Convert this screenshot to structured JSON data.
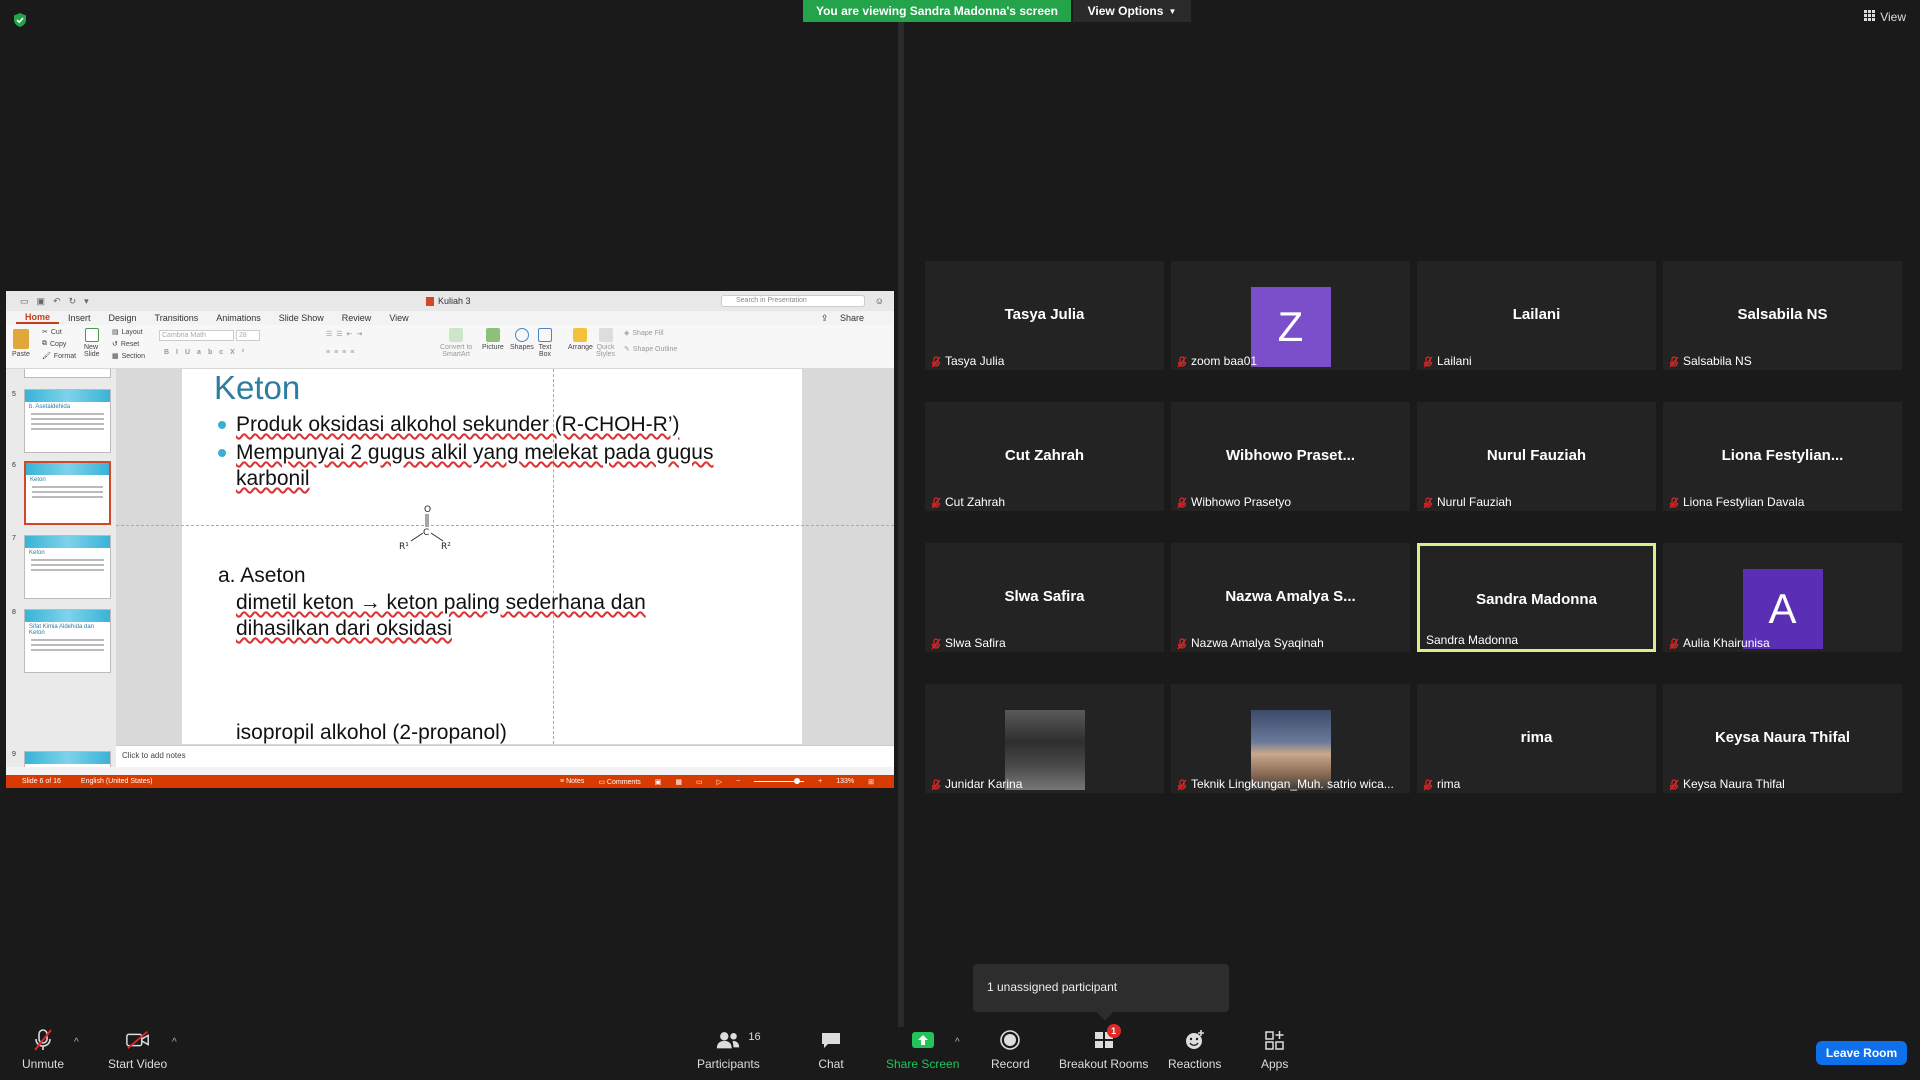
{
  "banner": {
    "viewing_text": "You are viewing Sandra Madonna's screen",
    "view_options_label": "View Options",
    "view_label": "View"
  },
  "ppt": {
    "file_name": "Kuliah 3",
    "search_placeholder": "Search in Presentation",
    "tabs": [
      "Home",
      "Insert",
      "Design",
      "Transitions",
      "Animations",
      "Slide Show",
      "Review",
      "View"
    ],
    "share_label": "Share",
    "ribbon": {
      "paste": "Paste",
      "cut": "Cut",
      "copy": "Copy",
      "format": "Format",
      "new_slide": "New\nSlide",
      "layout": "Layout",
      "reset": "Reset",
      "section": "Section",
      "font": "Cambria Math",
      "size": "28",
      "convert": "Convert to\nSmartArt",
      "picture": "Picture",
      "shapes": "Shapes",
      "text_box": "Text\nBox",
      "arrange": "Arrange",
      "quick_styles": "Quick\nStyles",
      "shape_fill": "Shape Fill",
      "shape_outline": "Shape Outline"
    },
    "thumb_numbers": [
      "5",
      "6",
      "7",
      "8",
      "9"
    ],
    "thumb_titles": [
      "b. Asetaldehida",
      "Keton",
      "Keton",
      "Sifat Kimia Aldehida dan Keton",
      ""
    ],
    "slide": {
      "title": "Keton",
      "bullet1": "Produk oksidasi alkohol sekunder (R-CHOH-R’)",
      "bullet2_line1": "Mempunyai 2 gugus alkil yang melekat pada gugus",
      "bullet2_line2": "karbonil",
      "struct_o": "O",
      "struct_c": "C",
      "struct_r1": "R¹",
      "struct_r2": "R²",
      "sub_a": "a. Aseton",
      "sub_a_line1": "dimetil keton → keton paling sederhana dan",
      "sub_a_line2": "dihasilkan dari oksidasi",
      "bottom": "isopropil alkohol (2-propanol)"
    },
    "notes_placeholder": "Click to add notes",
    "status": {
      "slide_of": "Slide 6 of 16",
      "language": "English (United States)",
      "notes": "Notes",
      "comments": "Comments",
      "zoom": "133%"
    }
  },
  "participants": [
    {
      "big": "Tasya Julia",
      "label": "Tasya Julia",
      "type": "name"
    },
    {
      "big": "Z",
      "label": "zoom baa01",
      "type": "avatar",
      "color": "#7b4fc9"
    },
    {
      "big": "Lailani",
      "label": "Lailani",
      "type": "name"
    },
    {
      "big": "Salsabila NS",
      "label": "Salsabila NS",
      "type": "name"
    },
    {
      "big": "Cut Zahrah",
      "label": "Cut Zahrah",
      "type": "name"
    },
    {
      "big": "Wibhowo Praset...",
      "label": "Wibhowo Prasetyo",
      "type": "name"
    },
    {
      "big": "Nurul Fauziah",
      "label": "Nurul Fauziah",
      "type": "name"
    },
    {
      "big": "Liona Festylian...",
      "label": "Liona Festylian Davala",
      "type": "name"
    },
    {
      "big": "Slwa Safira",
      "label": "Slwa Safira",
      "type": "name"
    },
    {
      "big": "Nazwa Amalya S...",
      "label": "Nazwa Amalya Syaqinah",
      "type": "name"
    },
    {
      "big": "Sandra Madonna",
      "label": "Sandra Madonna",
      "type": "name",
      "active": true
    },
    {
      "big": "A",
      "label": "Aulia Khairunisa",
      "type": "avatar",
      "color": "#5b2fb5"
    },
    {
      "big": "",
      "label": "Junidar Karina",
      "type": "photo"
    },
    {
      "big": "",
      "label": "Teknik Lingkungan_Muh. satrio wica...",
      "type": "photo"
    },
    {
      "big": "rima",
      "label": "rima",
      "type": "name"
    },
    {
      "big": "Keysa Naura Thifal",
      "label": "Keysa Naura Thifal",
      "type": "name"
    }
  ],
  "tooltip": {
    "text": "1 unassigned participant"
  },
  "toolbar": {
    "unmute": "Unmute",
    "start_video": "Start Video",
    "participants": "Participants",
    "participants_count": "16",
    "chat": "Chat",
    "share_screen": "Share Screen",
    "record": "Record",
    "breakout_rooms": "Breakout Rooms",
    "breakout_badge": "1",
    "reactions": "Reactions",
    "apps": "Apps",
    "leave": "Leave Room"
  },
  "colors": {
    "banner_green": "#23a44a",
    "leave_blue": "#0e71eb",
    "active_speaker": "#d6f08a",
    "mic_off_red": "#e02828",
    "ppt_accent": "#d24726"
  }
}
